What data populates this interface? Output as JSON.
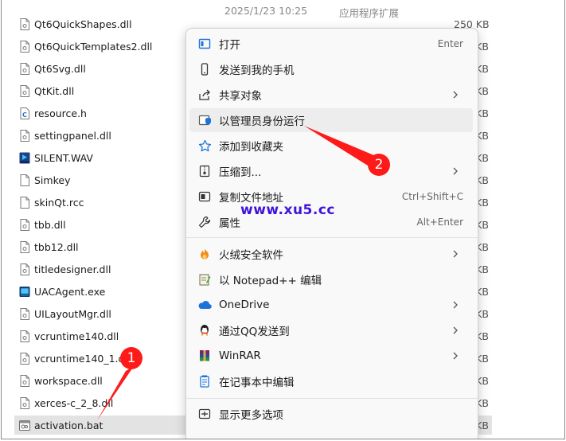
{
  "files": [
    {
      "name": "Qt6QuickShapes.dll",
      "date": "2025/1/23 10:25",
      "type": "应用程序扩展",
      "size": "250 KB",
      "icon": "dll-file-icon"
    },
    {
      "name": "Qt6QuickTemplates2.dll",
      "date": "",
      "type": "",
      "size": "KB",
      "icon": "dll-file-icon"
    },
    {
      "name": "Qt6Svg.dll",
      "date": "",
      "type": "",
      "size": "KB",
      "icon": "dll-file-icon"
    },
    {
      "name": "QtKit.dll",
      "date": "",
      "type": "",
      "size": "KB",
      "icon": "dll-file-icon"
    },
    {
      "name": "resource.h",
      "date": "",
      "type": "",
      "size": "KB",
      "icon": "c-header-file-icon"
    },
    {
      "name": "settingpanel.dll",
      "date": "",
      "type": "",
      "size": "KB",
      "icon": "dll-file-icon"
    },
    {
      "name": "SILENT.WAV",
      "date": "",
      "type": "",
      "size": "KB",
      "icon": "wav-file-icon"
    },
    {
      "name": "Simkey",
      "date": "",
      "type": "",
      "size": "KB",
      "icon": "generic-file-icon"
    },
    {
      "name": "skinQt.rcc",
      "date": "",
      "type": "",
      "size": "KB",
      "icon": "generic-file-icon"
    },
    {
      "name": "tbb.dll",
      "date": "",
      "type": "",
      "size": "KB",
      "icon": "dll-file-icon"
    },
    {
      "name": "tbb12.dll",
      "date": "",
      "type": "",
      "size": "KB",
      "icon": "dll-file-icon"
    },
    {
      "name": "titledesigner.dll",
      "date": "",
      "type": "",
      "size": "KB",
      "icon": "dll-file-icon"
    },
    {
      "name": "UACAgent.exe",
      "date": "",
      "type": "",
      "size": "KB",
      "icon": "exe-file-icon"
    },
    {
      "name": "UILayoutMgr.dll",
      "date": "",
      "type": "",
      "size": "KB",
      "icon": "dll-file-icon"
    },
    {
      "name": "vcruntime140.dll",
      "date": "",
      "type": "",
      "size": "KB",
      "icon": "dll-file-icon"
    },
    {
      "name": "vcruntime140_1.dll",
      "date": "",
      "type": "",
      "size": "KB",
      "icon": "dll-file-icon"
    },
    {
      "name": "workspace.dll",
      "date": "",
      "type": "",
      "size": "KB",
      "icon": "dll-file-icon"
    },
    {
      "name": "xerces-c_2_8.dll",
      "date": "",
      "type": "",
      "size": "KB",
      "icon": "dll-file-icon"
    },
    {
      "name": "activation.bat",
      "date": "",
      "type": "",
      "size": "KB",
      "icon": "bat-file-icon",
      "selected": true
    }
  ],
  "context_menu": {
    "items": [
      {
        "label": "打开",
        "shortcut": "Enter",
        "icon": "open-icon"
      },
      {
        "label": "发送到我的手机",
        "icon": "phone-icon"
      },
      {
        "label": "共享对象",
        "icon": "share-icon",
        "submenu": true
      },
      {
        "label": "以管理员身份运行",
        "icon": "admin-shield-icon",
        "hover": true
      },
      {
        "label": "添加到收藏夹",
        "icon": "star-icon"
      },
      {
        "label": "压缩到...",
        "icon": "zip-icon",
        "submenu": true
      },
      {
        "label": "复制文件地址",
        "shortcut": "Ctrl+Shift+C",
        "icon": "copy-path-icon"
      },
      {
        "label": "属性",
        "shortcut": "Alt+Enter",
        "icon": "wrench-icon"
      },
      {
        "label": "火绒安全软件",
        "icon": "huorong-icon",
        "submenu": true
      },
      {
        "label": "以 Notepad++ 编辑",
        "icon": "notepadpp-icon"
      },
      {
        "label": "OneDrive",
        "icon": "onedrive-icon",
        "submenu": true
      },
      {
        "label": "通过QQ发送到",
        "icon": "qq-icon",
        "submenu": true
      },
      {
        "label": "WinRAR",
        "icon": "winrar-icon",
        "submenu": true
      },
      {
        "label": "在记事本中编辑",
        "icon": "notepad-icon"
      },
      {
        "label": "显示更多选项",
        "icon": "more-options-icon"
      }
    ]
  },
  "watermark": "www.xu5.cc",
  "annotations": {
    "badge_1": "1",
    "badge_2": "2"
  },
  "colors": {
    "arrow_red": "#ff1a1a",
    "watermark": "#3f12d8",
    "accent_blue": "#1e73d8"
  }
}
